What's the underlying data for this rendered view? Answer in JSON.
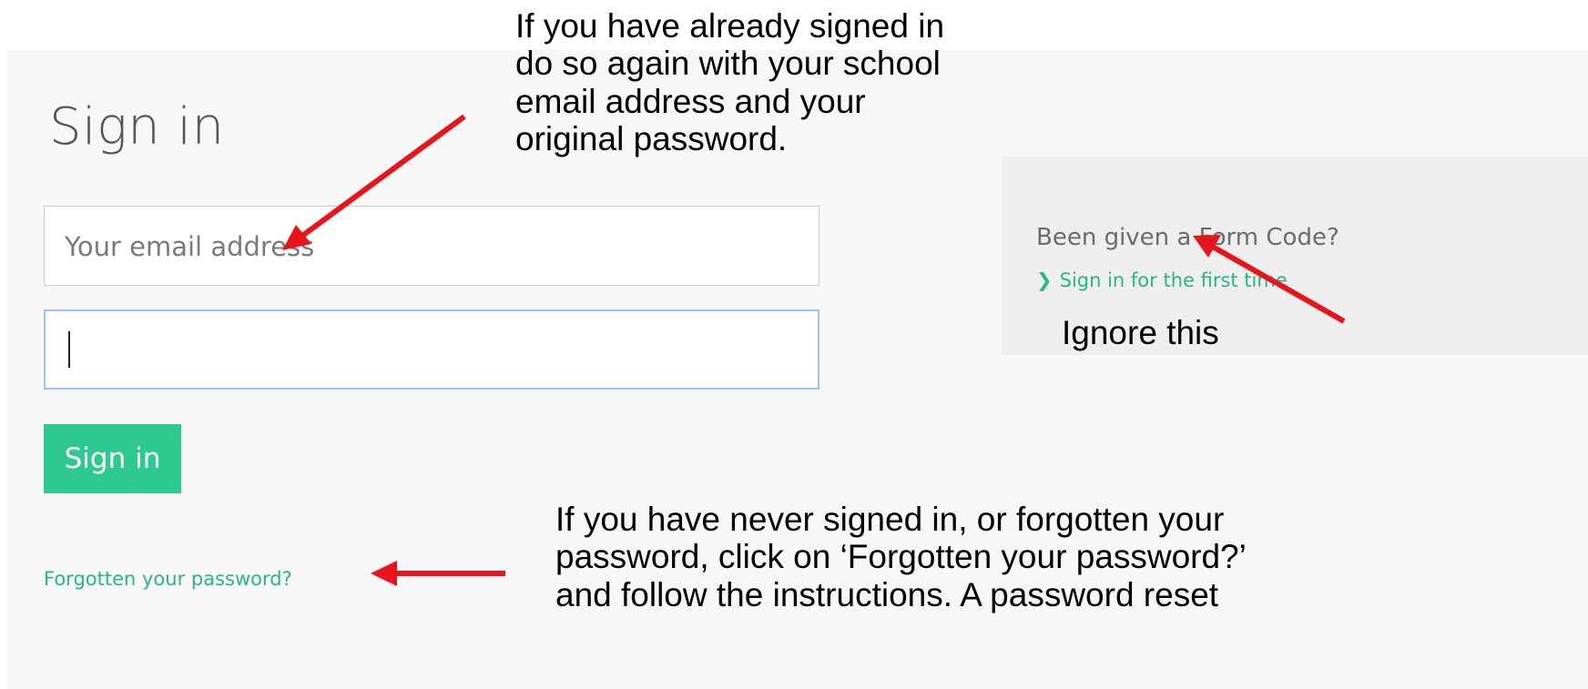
{
  "signin": {
    "title": "Sign in",
    "email_placeholder": "Your email address",
    "password_value": "",
    "submit_label": "Sign in",
    "forgot_label": "Forgotten your password?"
  },
  "form_code": {
    "question": "Been given a Form Code?",
    "link_label": "Sign in for the first time"
  },
  "annotations": {
    "note_existing": [
      "If you have already signed in",
      "do so again with your school",
      "email address and your",
      "original password."
    ],
    "note_ignore": "Ignore this",
    "note_never": [
      "If you have never signed in, or forgotten your",
      "password, click on ‘Forgotten your password?’",
      "and follow the instructions. A password reset"
    ]
  },
  "colors": {
    "accent": "#2ec98e",
    "link": "#27b77f",
    "annotation_arrow": "#e8141c"
  }
}
